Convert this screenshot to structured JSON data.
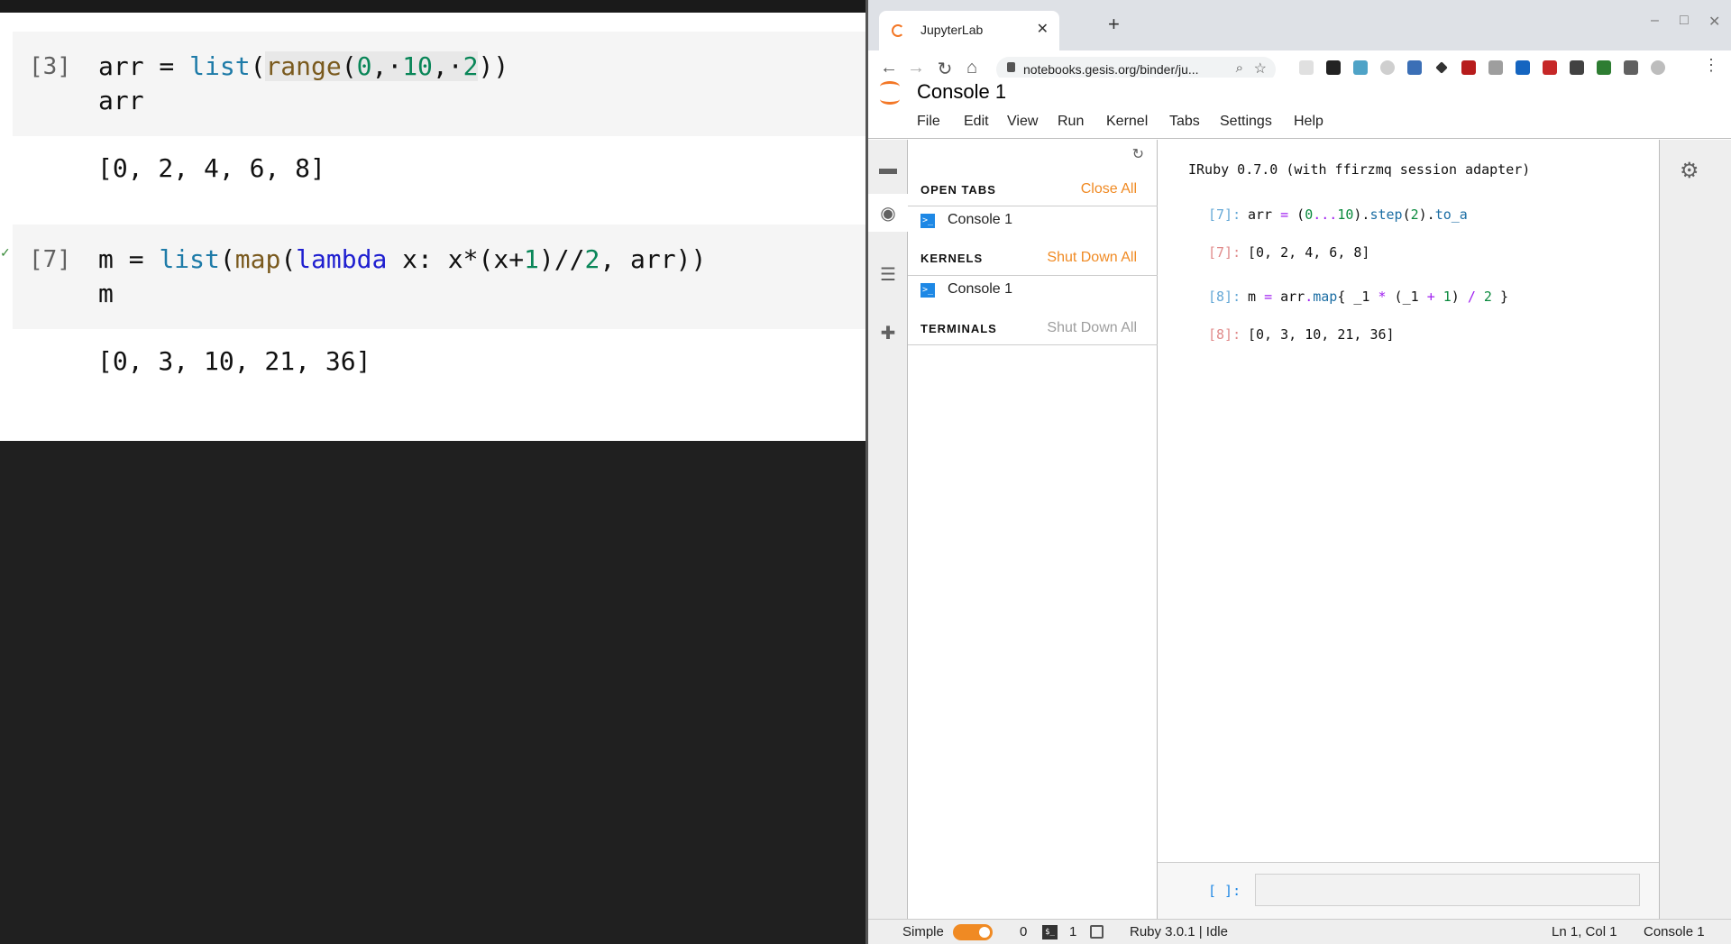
{
  "notebook": {
    "cells": [
      {
        "prompt": "[3]",
        "line1": {
          "var": "arr",
          "op": " = ",
          "fn": "list",
          "p1": "(",
          "bi": "range",
          "p2": "(",
          "n1": "0",
          "c1": ",·",
          "n2": "10",
          "c2": ",·",
          "n3": "2",
          "p3": "))"
        },
        "line2": "arr",
        "output": "[0, 2, 4, 6, 8]"
      },
      {
        "prompt": "[7]",
        "line1": {
          "var": "m",
          "op": " = ",
          "fn": "list",
          "p1": "(",
          "bi": "map",
          "p2": "(",
          "lam": "lambda",
          "rest1": " x: x*(x+",
          "n1": "1",
          "rest2": ")//",
          "n2": "2",
          "rest3": ", arr))"
        },
        "line2": "m",
        "output": "[0, 3, 10, 21, 36]"
      }
    ]
  },
  "browser": {
    "tab_title": "JupyterLab",
    "url": "notebooks.gesis.org/binder/ju...",
    "new_tab": "+",
    "tab_close": "✕",
    "win_min": "–",
    "win_max": "□",
    "win_close": "✕"
  },
  "jupyterlab": {
    "doc_title": "Console 1",
    "menu": [
      "File",
      "Edit",
      "View",
      "Run",
      "Kernel",
      "Tabs",
      "Settings",
      "Help"
    ],
    "running": {
      "open_tabs": {
        "title": "OPEN TABS",
        "action": "Close All",
        "items": [
          "Console 1"
        ]
      },
      "kernels": {
        "title": "KERNELS",
        "action": "Shut Down All",
        "items": [
          "Console 1"
        ]
      },
      "terminals": {
        "title": "TERMINALS",
        "action": "Shut Down All"
      }
    },
    "console": {
      "banner": "IRuby 0.7.0 (with ffirzmq session adapter)",
      "cells": [
        {
          "in_prompt": "[7]:",
          "out_prompt": "[7]:",
          "output": "[0, 2, 4, 6, 8]"
        },
        {
          "in_prompt": "[8]:",
          "out_prompt": "[8]:",
          "output": "[0, 3, 10, 21, 36]"
        }
      ],
      "code1": {
        "a": "arr ",
        "eq": "=",
        "b": " (",
        "n0": "0",
        "dots": "...",
        "n10": "10",
        "c": ").",
        "step": "step",
        "d": "(",
        "n2": "2",
        "e": ").",
        "to_a": "to_a"
      },
      "code2": {
        "a": "m ",
        "eq": "=",
        "b": " arr",
        "dot": ".",
        "map": "map",
        "c": "{ _1 ",
        "mul": "*",
        "d": " (_1 ",
        "plus": "+",
        "e": " ",
        "n1": "1",
        "f": ") ",
        "div": "/",
        "g": " ",
        "n2": "2",
        "h": " }"
      },
      "input_prompt": "[ ]:"
    },
    "status": {
      "mode": "Simple",
      "count0": "0",
      "count1": "1",
      "kernel": "Ruby 3.0.1 | Idle",
      "position": "Ln 1, Col 1",
      "doc": "Console 1"
    }
  }
}
